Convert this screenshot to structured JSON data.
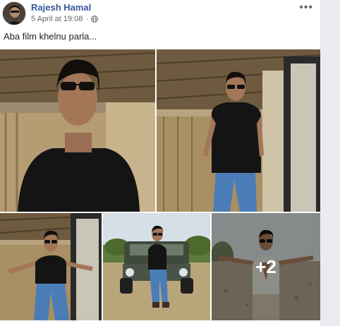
{
  "post": {
    "author": "Rajesh Hamal",
    "timestamp": "5 April at 19:08",
    "privacy_icon": "globe-icon",
    "more_icon": "more-options-icon",
    "more_label": "•••",
    "caption": "Aba film khelnu parla...",
    "photos": [
      {
        "description": "Man in sunglasses and black t-shirt, close-up on porch"
      },
      {
        "description": "Man in black t-shirt and jeans standing on porch"
      },
      {
        "description": "Man with arms outstretched on porch"
      },
      {
        "description": "Man sitting on front of jeep outdoors"
      },
      {
        "description": "Man in sleeveless vest with arms outstretched"
      }
    ],
    "extra_photos_label": "+2"
  },
  "colors": {
    "author_link": "#385898",
    "meta_text": "#616770",
    "background": "#e9ebee"
  }
}
